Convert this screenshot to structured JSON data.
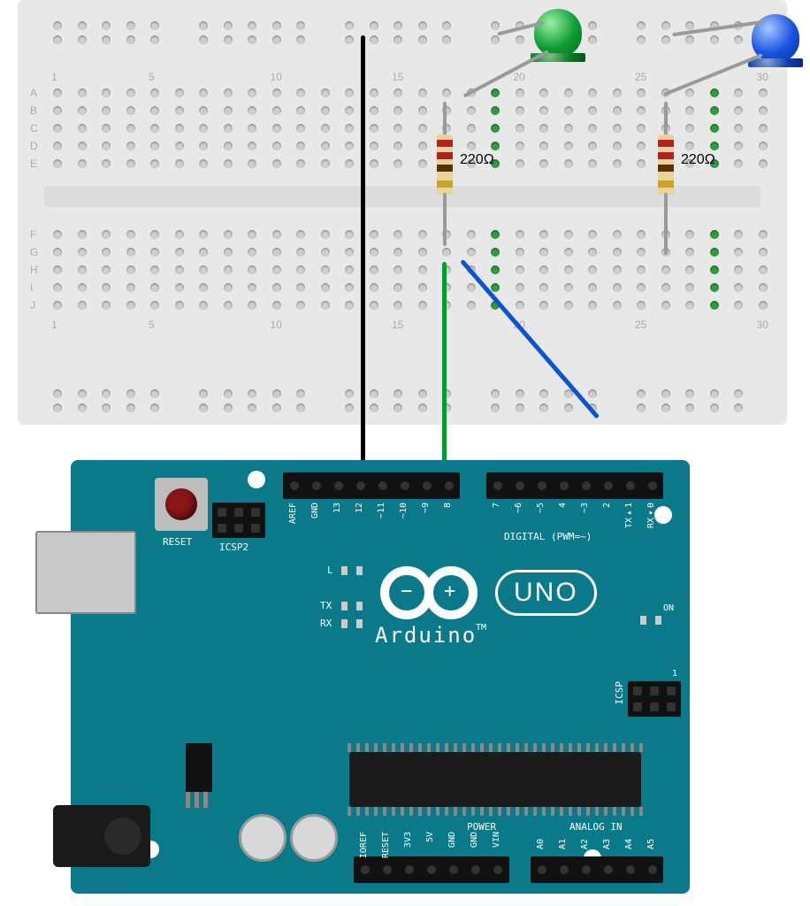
{
  "diagram": {
    "type": "wiring-diagram",
    "microcontroller": "Arduino UNO",
    "components": [
      {
        "name": "green-led",
        "connected_via": "220Ω resistor",
        "arduino_pin": "~10",
        "other_leg": "GND rail"
      },
      {
        "name": "blue-led",
        "connected_via": "220Ω resistor",
        "arduino_pin": "~9",
        "other_leg": "GND rail"
      }
    ],
    "wires": [
      {
        "color": "black",
        "from": "Arduino GND",
        "to": "breadboard top ground rail"
      },
      {
        "color": "green",
        "from": "Arduino ~10",
        "to": "breadboard col 19 (green LED resistor)"
      },
      {
        "color": "blue",
        "from": "Arduino ~9",
        "to": "breadboard col 28 (blue LED resistor)"
      }
    ]
  },
  "labels": {
    "resistor1": "220Ω",
    "resistor2": "220Ω",
    "reset": "RESET",
    "icsp2": "ICSP2",
    "icsp": "ICSP",
    "L": "L",
    "TX": "TX",
    "RX": "RX",
    "arduino": "Arduino",
    "tm": "TM",
    "uno": "UNO",
    "on": "ON",
    "digital_header": "DIGITAL (PWM=~)",
    "power_header": "POWER",
    "analog_header": "ANALOG IN",
    "logo_minus": "−",
    "logo_plus": "+",
    "icsp_pin1": "1"
  },
  "pin_labels": {
    "top_left": [
      "AREF",
      "GND",
      "13",
      "12",
      "~11",
      "~10",
      "~9",
      "8"
    ],
    "top_right": [
      "7",
      "~6",
      "~5",
      "4",
      "~3",
      "2",
      "TX▸1",
      "RX◂0"
    ],
    "power": [
      "IOREF",
      "RESET",
      "3V3",
      "5V",
      "GND",
      "GND",
      "VIN"
    ],
    "analog": [
      "A0",
      "A1",
      "A2",
      "A3",
      "A4",
      "A5"
    ]
  },
  "breadboard": {
    "rows": [
      "A",
      "B",
      "C",
      "D",
      "E",
      "F",
      "G",
      "H",
      "I",
      "J"
    ],
    "col_marks": [
      "1",
      "5",
      "10",
      "15",
      "20",
      "25",
      "30"
    ]
  }
}
